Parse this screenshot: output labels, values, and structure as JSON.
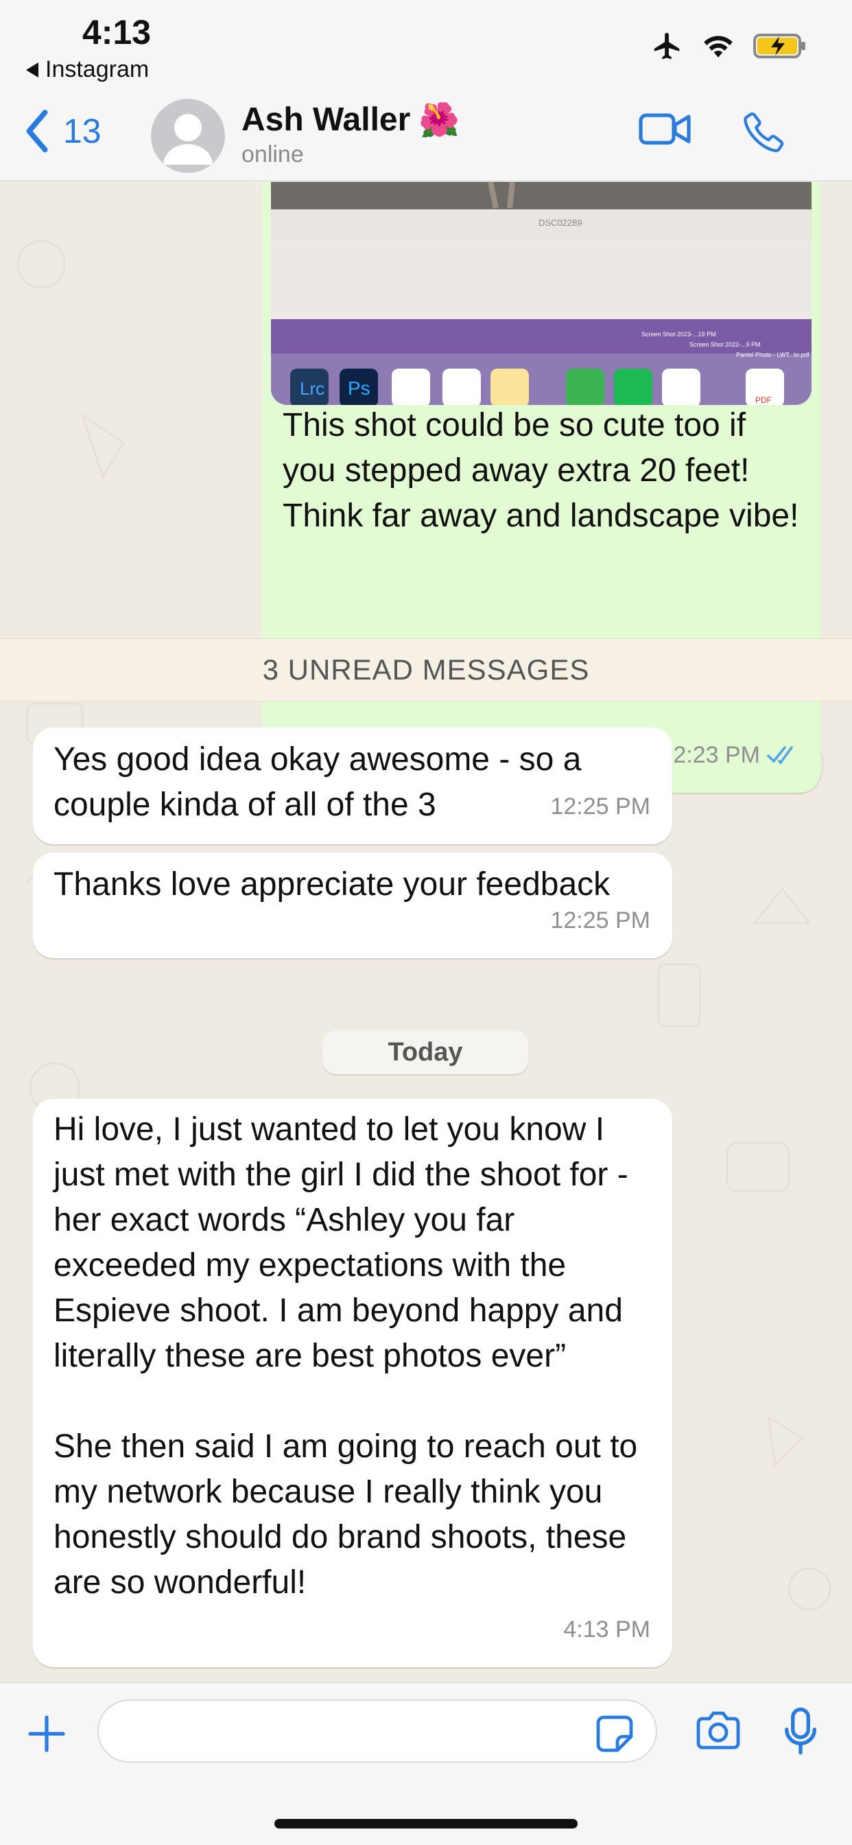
{
  "status_bar": {
    "time": "4:13",
    "back_app": "Instagram"
  },
  "header": {
    "back_count": "13",
    "contact_name": "Ash Waller",
    "contact_emoji": "🌺",
    "contact_status": "online"
  },
  "chat": {
    "image_caption": "DSC02289",
    "dock_labels": {
      "lrc": "Lrc",
      "ps": "Ps",
      "pdf": "PDF"
    },
    "desktop_files": [
      "Screen Shot 2023-...19 PM",
      "Screen Shot 2022-...9 PM",
      "Pantel Photo - LWT...to.pdf"
    ],
    "outgoing": {
      "text": "This shot could be so cute too if you stepped away extra 20 feet! Think far away and landscape vibe!",
      "time": "12:23 PM"
    },
    "unread_banner": "3 UNREAD MESSAGES",
    "incoming_1": {
      "text": "Yes good idea okay awesome - so a couple kinda of all of the 3",
      "time": "12:25 PM"
    },
    "incoming_2": {
      "text": "Thanks love appreciate your feedback",
      "time": "12:25 PM"
    },
    "day_label": "Today",
    "incoming_3": {
      "para1": "Hi love, I just wanted to let you know I just met with the girl I did the shoot for - her exact words “Ashley you far exceeded my expectations with the Espieve shoot. I am beyond happy and literally these are best photos ever”",
      "para2": "She then said I am going to reach out to my network because I really think you honestly should do brand shoots, these are so wonderful!",
      "time": "4:13 PM"
    }
  },
  "input": {
    "placeholder": ""
  },
  "colors": {
    "accent": "#2a7bde",
    "outgoing_bubble": "#e2fbd2",
    "chat_bg": "#efeae2",
    "read_ticks": "#53a6e8"
  }
}
